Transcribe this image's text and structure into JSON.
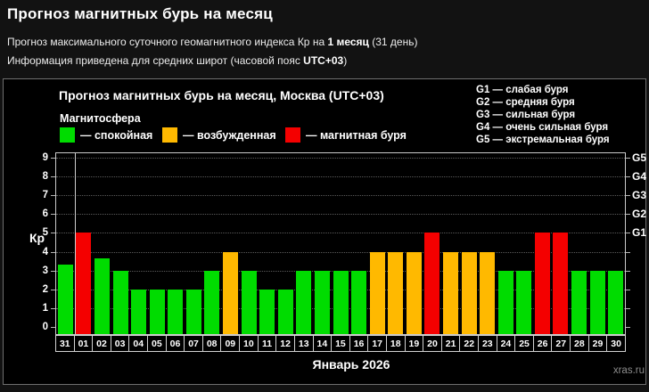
{
  "header": {
    "title": "Прогноз магнитных бурь на месяц",
    "subtitle": {
      "prefix": "Прогноз максимального суточного геомагнитного индекса Кр на ",
      "bold": "1 месяц",
      "suffix": " (31 день)"
    },
    "info": {
      "prefix": "Информация приведена для средних широт (часовой пояс ",
      "bold": "UTC+03",
      "suffix": ")"
    }
  },
  "panel": {
    "legend_title": "Магнитосфера",
    "legend": [
      {
        "key": "quiet",
        "label": "— спокойная"
      },
      {
        "key": "unsettled",
        "label": "— возбужденная"
      },
      {
        "key": "storm",
        "label": "— магнитная буря"
      }
    ],
    "g_scale": [
      "G1 — слабая буря",
      "G2 — средняя буря",
      "G3 — сильная буря",
      "G4 — очень сильная буря",
      "G5 — экстремальная буря"
    ]
  },
  "chart_data": {
    "type": "bar",
    "title": "Прогноз магнитных бурь на месяц, Москва (UTC+03)",
    "xlabel": "Январь 2026",
    "ylabel": "Кр",
    "ylim": [
      0,
      9
    ],
    "yticks": [
      0,
      1,
      2,
      3,
      4,
      5,
      6,
      7,
      8,
      9
    ],
    "grid": "dotted horizontal",
    "legend_position": "top-left",
    "categories": [
      "31",
      "01",
      "02",
      "03",
      "04",
      "05",
      "06",
      "07",
      "08",
      "09",
      "10",
      "11",
      "12",
      "13",
      "14",
      "15",
      "16",
      "17",
      "18",
      "19",
      "20",
      "21",
      "22",
      "23",
      "24",
      "25",
      "26",
      "27",
      "28",
      "29",
      "30"
    ],
    "values": [
      3.33,
      5,
      3.67,
      3,
      2,
      2,
      2,
      2,
      3,
      4,
      3,
      2,
      2,
      3,
      3,
      3,
      3,
      4,
      4,
      4,
      5,
      4,
      4,
      4,
      3,
      3,
      5,
      5,
      3,
      3,
      3
    ],
    "statuses": [
      "quiet",
      "storm",
      "quiet",
      "quiet",
      "quiet",
      "quiet",
      "quiet",
      "quiet",
      "quiet",
      "unsettled",
      "quiet",
      "quiet",
      "quiet",
      "quiet",
      "quiet",
      "quiet",
      "quiet",
      "unsettled",
      "unsettled",
      "unsettled",
      "storm",
      "unsettled",
      "unsettled",
      "unsettled",
      "quiet",
      "quiet",
      "storm",
      "storm",
      "quiet",
      "quiet",
      "quiet"
    ],
    "status_colors": {
      "quiet": "#00dc00",
      "unsettled": "#ffb900",
      "storm": "#f40000"
    },
    "right_axis_labels": [
      {
        "value": 5,
        "label": "G1"
      },
      {
        "value": 6,
        "label": "G2"
      },
      {
        "value": 7,
        "label": "G3"
      },
      {
        "value": 8,
        "label": "G4"
      },
      {
        "value": 9,
        "label": "G5"
      }
    ],
    "month_separator_after_index": 0
  },
  "footer": {
    "watermark": "xras.ru"
  }
}
